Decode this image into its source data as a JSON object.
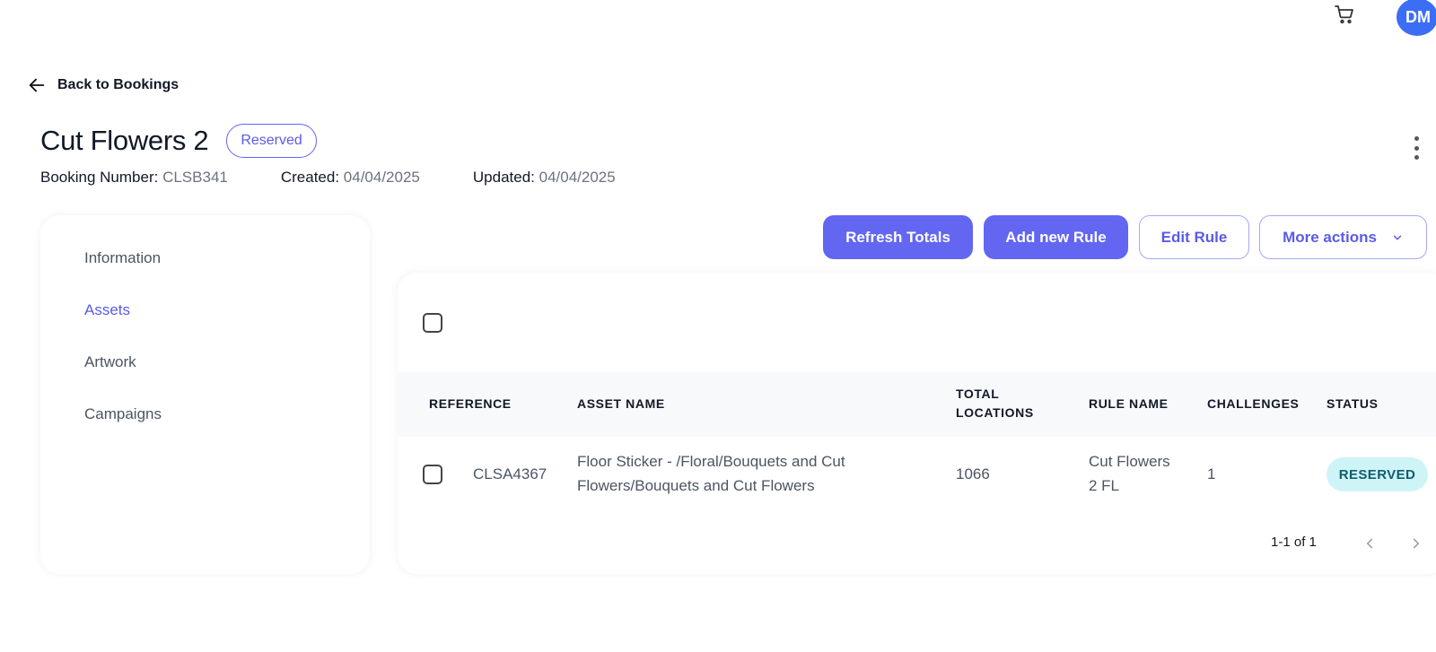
{
  "header": {
    "avatar_initials": "DM",
    "cart_icon": "shopping-cart-icon"
  },
  "back_link": {
    "label": "Back to Bookings"
  },
  "booking": {
    "title": "Cut Flowers 2",
    "status": "Reserved",
    "number_label": "Booking Number:",
    "number": "CLSB341",
    "created_label": "Created:",
    "created": "04/04/2025",
    "updated_label": "Updated:",
    "updated": "04/04/2025"
  },
  "sidebar": {
    "items": [
      {
        "label": "Information"
      },
      {
        "label": "Assets"
      },
      {
        "label": "Artwork"
      },
      {
        "label": "Campaigns"
      }
    ],
    "active": "Assets"
  },
  "actions": {
    "refresh": "Refresh Totals",
    "add_rule": "Add new Rule",
    "edit_rule": "Edit Rule",
    "more": "More actions"
  },
  "table": {
    "headers": {
      "reference": "REFERENCE",
      "asset_name": "ASSET NAME",
      "total_locations_1": "TOTAL",
      "total_locations_2": "LOCATIONS",
      "rule_name": "RULE NAME",
      "challenges": "CHALLENGES",
      "status": "STATUS"
    },
    "rows": [
      {
        "reference": "CLSA4367",
        "asset_name_1": "Floor Sticker - /Floral/Bouquets and Cut",
        "asset_name_2": "Flowers/Bouquets and Cut Flowers",
        "total_locations": "1066",
        "rule_name_1": "Cut Flowers",
        "rule_name_2": "2 FL",
        "challenges": "1",
        "status": "RESERVED"
      }
    ],
    "pagination": "1-1 of 1"
  },
  "colors": {
    "primary": "#6366f1",
    "avatar": "#3b6ef5",
    "status_badge_bg": "#cff4f8",
    "status_badge_text": "#0f5e6b"
  }
}
